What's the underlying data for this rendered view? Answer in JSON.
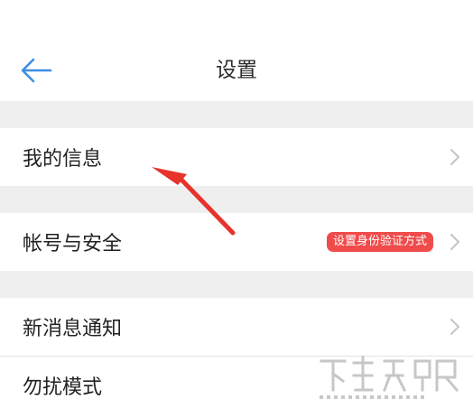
{
  "header": {
    "title": "设置",
    "back_icon": "back-arrow-icon",
    "accent_color": "#3e8ee6"
  },
  "rows": [
    {
      "label": "我的信息",
      "icon": "chevron-right-icon"
    },
    {
      "label": "帐号与安全",
      "badge": "设置身份验证方式",
      "badge_color": "#ef4b4b",
      "icon": "chevron-right-icon"
    },
    {
      "label": "新消息通知",
      "icon": "chevron-right-icon"
    },
    {
      "label": "勿扰模式"
    }
  ],
  "annotation": {
    "icon": "red-pointer-arrow-icon",
    "color": "#e8322c"
  },
  "watermark": {
    "icon": "site-logo-watermark-icon"
  }
}
